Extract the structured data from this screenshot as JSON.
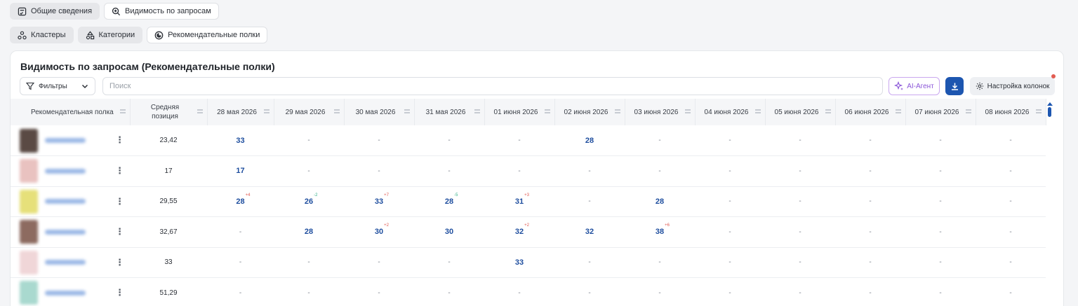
{
  "tabs_row1": [
    {
      "label": "Общие сведения",
      "icon": "checklist-icon",
      "active": true
    },
    {
      "label": "Видимость по запросам",
      "icon": "search-zoom-icon",
      "active": false
    }
  ],
  "tabs_row2": [
    {
      "label": "Кластеры",
      "icon": "clusters-icon",
      "active": true
    },
    {
      "label": "Категории",
      "icon": "categories-icon",
      "active": true
    },
    {
      "label": "Рекомендательные полки",
      "icon": "shelves-icon",
      "active": false
    }
  ],
  "card": {
    "title": "Видимость по запросам (Рекомендательные полки)",
    "filters_label": "Фильтры",
    "search_placeholder": "Поиск",
    "ai_label": "AI-Агент",
    "columns_label": "Настройка колонок"
  },
  "colors": {
    "accent": "#1d56b0",
    "value": "#1d4d9e",
    "delta_up": "#e0574e",
    "delta_down": "#2fae86",
    "ai": "#8a55d8"
  },
  "table": {
    "headers": [
      "Рекомендательная полка",
      "Средняя позиция",
      "28 мая 2026",
      "29 мая 2026",
      "30 мая 2026",
      "31 мая 2026",
      "01 июня 2026",
      "02 июня 2026",
      "03 июня 2026",
      "04 июня 2026",
      "05 июня 2026",
      "06 июня 2026",
      "07 июня 2026",
      "08 июня 2026"
    ],
    "avg_header_line1": "Средняя",
    "avg_header_line2": "позиция",
    "rows": [
      {
        "avg": "23,42",
        "cells": [
          {
            "v": "33"
          },
          {
            "v": "-"
          },
          {
            "v": "-"
          },
          {
            "v": "-"
          },
          {
            "v": "-"
          },
          {
            "v": "28"
          },
          {
            "v": "-"
          },
          {
            "v": "-"
          },
          {
            "v": "-"
          },
          {
            "v": "-"
          },
          {
            "v": "-"
          },
          {
            "v": "-"
          }
        ]
      },
      {
        "avg": "17",
        "cells": [
          {
            "v": "17"
          },
          {
            "v": "-"
          },
          {
            "v": "-"
          },
          {
            "v": "-"
          },
          {
            "v": "-"
          },
          {
            "v": "-"
          },
          {
            "v": "-"
          },
          {
            "v": "-"
          },
          {
            "v": "-"
          },
          {
            "v": "-"
          },
          {
            "v": "-"
          },
          {
            "v": "-"
          }
        ]
      },
      {
        "avg": "29,55",
        "cells": [
          {
            "v": "28",
            "d": "+4",
            "dir": "up"
          },
          {
            "v": "26",
            "d": "-2",
            "dir": "down"
          },
          {
            "v": "33",
            "d": "+7",
            "dir": "up"
          },
          {
            "v": "28",
            "d": "-5",
            "dir": "down"
          },
          {
            "v": "31",
            "d": "+3",
            "dir": "up"
          },
          {
            "v": "-"
          },
          {
            "v": "28"
          },
          {
            "v": "-"
          },
          {
            "v": "-"
          },
          {
            "v": "-"
          },
          {
            "v": "-"
          },
          {
            "v": "-"
          }
        ]
      },
      {
        "avg": "32,67",
        "cells": [
          {
            "v": "-"
          },
          {
            "v": "28"
          },
          {
            "v": "30",
            "d": "+2",
            "dir": "up"
          },
          {
            "v": "30"
          },
          {
            "v": "32",
            "d": "+2",
            "dir": "up"
          },
          {
            "v": "32"
          },
          {
            "v": "38",
            "d": "+6",
            "dir": "up"
          },
          {
            "v": "-"
          },
          {
            "v": "-"
          },
          {
            "v": "-"
          },
          {
            "v": "-"
          },
          {
            "v": "-"
          }
        ]
      },
      {
        "avg": "33",
        "cells": [
          {
            "v": "-"
          },
          {
            "v": "-"
          },
          {
            "v": "-"
          },
          {
            "v": "-"
          },
          {
            "v": "33"
          },
          {
            "v": "-"
          },
          {
            "v": "-"
          },
          {
            "v": "-"
          },
          {
            "v": "-"
          },
          {
            "v": "-"
          },
          {
            "v": "-"
          },
          {
            "v": "-"
          }
        ]
      },
      {
        "avg": "51,29",
        "cells": [
          {
            "v": "-"
          },
          {
            "v": "-"
          },
          {
            "v": "-"
          },
          {
            "v": "-"
          },
          {
            "v": "-"
          },
          {
            "v": "-"
          },
          {
            "v": "-"
          },
          {
            "v": "-"
          },
          {
            "v": "-"
          },
          {
            "v": "-"
          },
          {
            "v": "-"
          },
          {
            "v": "-"
          }
        ]
      }
    ],
    "thumb_colors": [
      "#5a4a44",
      "#e9c2c0",
      "#e6e07a",
      "#8d6b60",
      "#f0d6d8",
      "#a9d9cf"
    ]
  }
}
